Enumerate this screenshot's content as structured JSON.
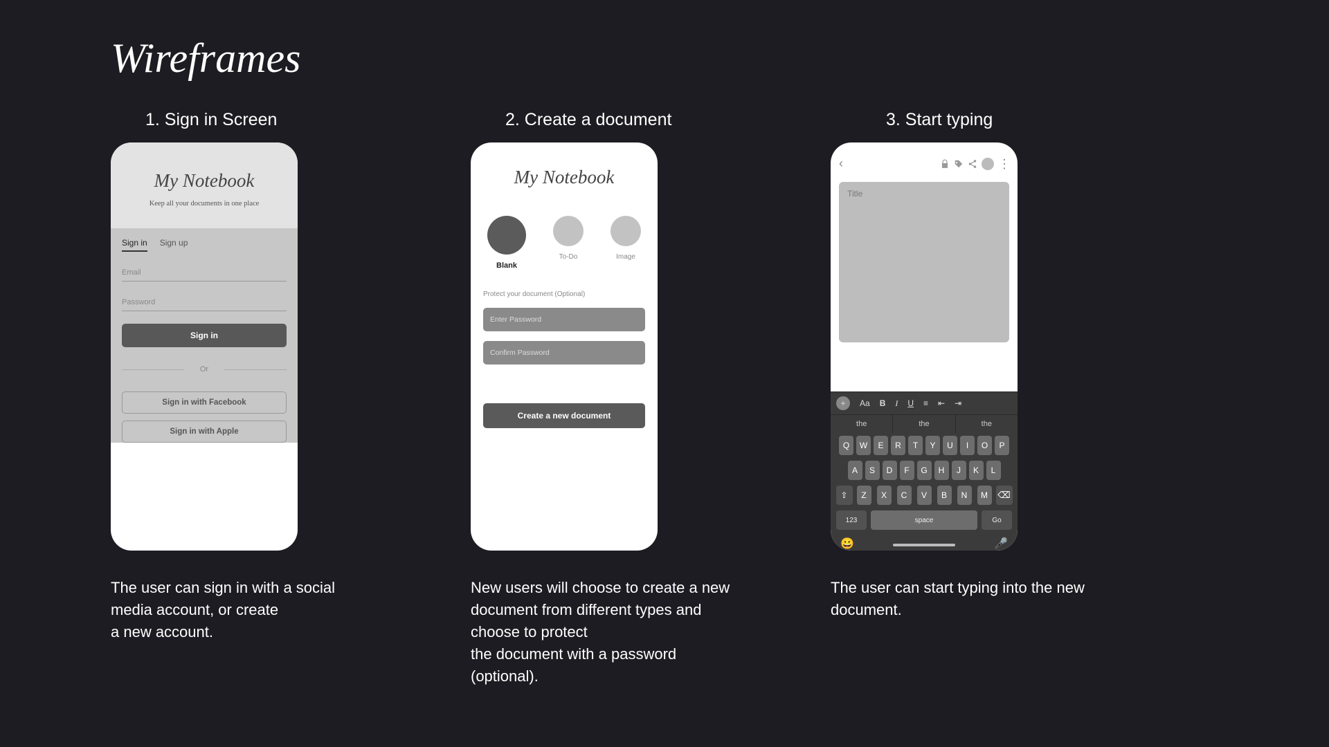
{
  "page_title": "Wireframes",
  "steps": [
    {
      "title": "1. Sign in Screen",
      "app_name": "My Notebook",
      "tagline": "Keep all your documents in one place",
      "tabs": {
        "signin": "Sign in",
        "signup": "Sign up"
      },
      "fields": {
        "email": "Email",
        "password": "Password"
      },
      "signin_btn": "Sign in",
      "or": "Or",
      "fb_btn": "Sign in with Facebook",
      "apple_btn": "Sign in with Apple",
      "desc": "The user can sign in with a social media account, or create\na new account."
    },
    {
      "title": "2. Create a document",
      "app_name": "My Notebook",
      "types": {
        "blank": "Blank",
        "todo": "To-Do",
        "image": "Image"
      },
      "protect_label": "Protect your document (Optional)",
      "pw1": "Enter Password",
      "pw2": "Confirm Password",
      "create_btn": "Create a new document",
      "desc": "New users will choose to create a new document from different types and choose to protect\nthe document with a password (optional)."
    },
    {
      "title": "3. Start typing",
      "title_ph": "Title",
      "fmt": {
        "aa": "Aa",
        "b": "B",
        "i": "I",
        "u": "U"
      },
      "sugg": [
        "the",
        "the",
        "the"
      ],
      "rows": {
        "r1": [
          "Q",
          "W",
          "E",
          "R",
          "T",
          "Y",
          "U",
          "I",
          "O",
          "P"
        ],
        "r2": [
          "A",
          "S",
          "D",
          "F",
          "G",
          "H",
          "J",
          "K",
          "L"
        ],
        "r3": [
          "Z",
          "X",
          "C",
          "V",
          "B",
          "N",
          "M"
        ]
      },
      "shift": "⇧",
      "del": "⌫",
      "num": "123",
      "space": "space",
      "go": "Go",
      "emoji": "😀",
      "mic": "🎤",
      "desc": "The user can start typing into the new document."
    }
  ]
}
